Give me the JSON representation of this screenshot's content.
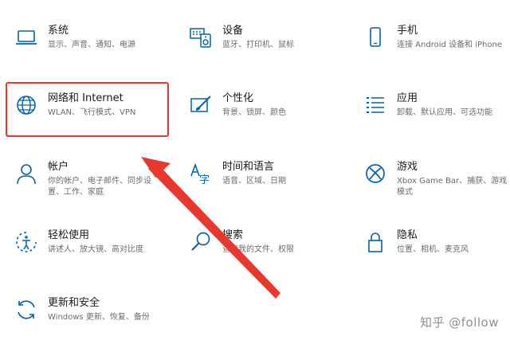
{
  "tiles": [
    {
      "title": "系统",
      "desc": "显示、声音、通知、电源",
      "icon": "laptop-icon"
    },
    {
      "title": "设备",
      "desc": "蓝牙、打印机、鼠标",
      "icon": "keyboard-speaker-icon"
    },
    {
      "title": "手机",
      "desc": "连接 Android 设备和 iPhone",
      "icon": "phone-icon"
    },
    {
      "title": "网络和 Internet",
      "desc": "WLAN、飞行模式、VPN",
      "icon": "globe-icon"
    },
    {
      "title": "个性化",
      "desc": "背景、锁屏、颜色",
      "icon": "paint-brush-icon"
    },
    {
      "title": "应用",
      "desc": "卸载、默认应用、可选功能",
      "icon": "apps-list-icon"
    },
    {
      "title": "帐户",
      "desc": "你的帐户、电子邮件、同步设\n置、工作、家庭",
      "icon": "person-icon"
    },
    {
      "title": "时间和语言",
      "desc": "语音、区域、日期",
      "icon": "language-icon"
    },
    {
      "title": "游戏",
      "desc": "Xbox Game Bar、捕获、游戏\n模式",
      "icon": "xbox-icon"
    },
    {
      "title": "轻松使用",
      "desc": "讲述人、放大镜、高对比度",
      "icon": "ease-of-access-icon"
    },
    {
      "title": "搜索",
      "desc": "查找我的文件、权限",
      "icon": "search-icon"
    },
    {
      "title": "隐私",
      "desc": "位置、相机、麦克风",
      "icon": "lock-icon"
    },
    {
      "title": "更新和安全",
      "desc": "Windows 更新、恢复、备份",
      "icon": "sync-icon"
    }
  ],
  "watermark": "知乎 @follow",
  "colors": {
    "accent": "#0063b1",
    "highlight": "#e8382e"
  }
}
